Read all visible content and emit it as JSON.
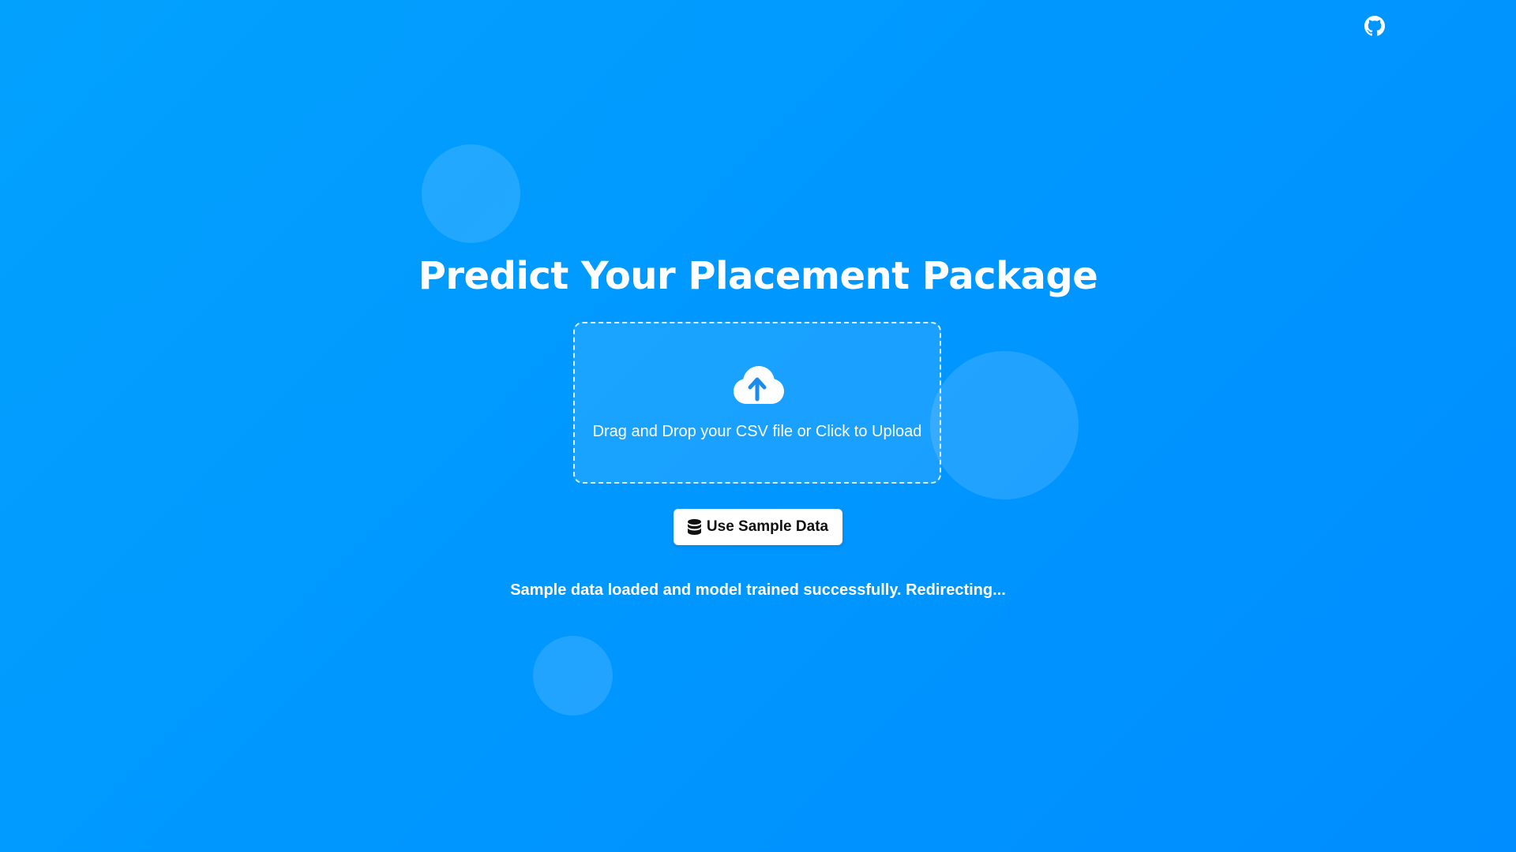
{
  "header": {
    "github_icon": "github-icon"
  },
  "hero": {
    "title": "Predict Your Placement Package"
  },
  "upload": {
    "icon": "cloud-upload-icon",
    "prompt": "Drag and Drop your CSV file or Click to Upload"
  },
  "sample": {
    "icon": "database-icon",
    "label": "Use Sample Data"
  },
  "status": {
    "message": "Sample data loaded and model trained successfully. Redirecting..."
  },
  "colors": {
    "background_start": "#03a1fe",
    "background_end": "#008dff",
    "text": "#ffffff",
    "icon_accent": "#1a8cf0"
  }
}
